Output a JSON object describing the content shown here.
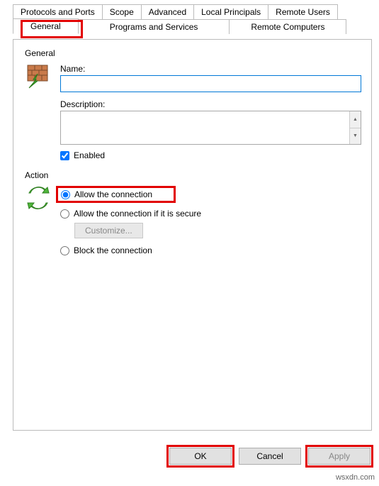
{
  "tabs": {
    "row1": [
      {
        "label": "Protocols and Ports"
      },
      {
        "label": "Scope"
      },
      {
        "label": "Advanced"
      },
      {
        "label": "Local Principals"
      },
      {
        "label": "Remote Users"
      }
    ],
    "row2": [
      {
        "label": "General",
        "active": true
      },
      {
        "label": "Programs and Services"
      },
      {
        "label": "Remote Computers"
      }
    ]
  },
  "general_group": {
    "title": "General",
    "name_label": "Name:",
    "name_value": "",
    "description_label": "Description:",
    "description_value": "",
    "enabled_label": "Enabled",
    "enabled_checked": true
  },
  "action_group": {
    "title": "Action",
    "options": {
      "allow": "Allow the connection",
      "allow_secure": "Allow the connection if it is secure",
      "block": "Block the connection"
    },
    "selected": "allow",
    "customize_label": "Customize..."
  },
  "buttons": {
    "ok": "OK",
    "cancel": "Cancel",
    "apply": "Apply"
  },
  "watermark": "wsxdn.com"
}
